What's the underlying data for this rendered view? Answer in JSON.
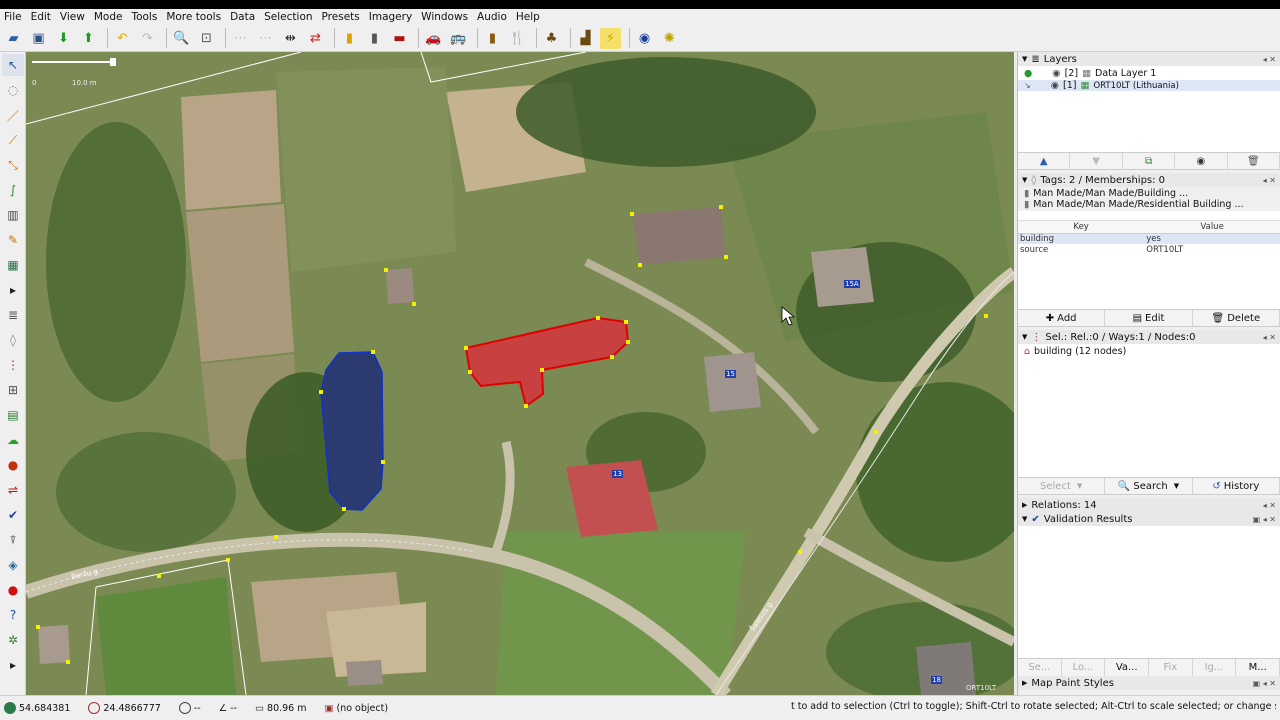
{
  "menu": [
    "File",
    "Edit",
    "View",
    "Mode",
    "Tools",
    "More tools",
    "Data",
    "Selection",
    "Presets",
    "Imagery",
    "Windows",
    "Audio",
    "Help"
  ],
  "map": {
    "scale_left": "0",
    "scale_right": "10.0 m",
    "street_berzu": "Beržų g.",
    "street_salesos": "Šalesos g.",
    "label_1": "15A",
    "label_2": "15",
    "label_3": "13",
    "label_4": "18",
    "watermark": "ORT10LT"
  },
  "layers": {
    "title": "Layers",
    "items": [
      {
        "index": "[2]",
        "name": "Data Layer 1"
      },
      {
        "index": "[1]",
        "name": "ORT10LT (Lithuania)"
      }
    ]
  },
  "tags": {
    "title": "Tags: 2 / Memberships: 0",
    "presets": [
      "Man Made/Man Made/Building ...",
      "Man Made/Man Made/Residential Building ..."
    ],
    "key_header": "Key",
    "value_header": "Value",
    "rows": [
      {
        "key": "building",
        "value": "yes"
      },
      {
        "key": "source",
        "value": "ORT10LT"
      }
    ],
    "add": "Add",
    "edit": "Edit",
    "delete": "Delete"
  },
  "selection": {
    "title": "Sel.: Rel.:0 / Ways:1 / Nodes:0",
    "item": "building (12 nodes)",
    "select": "Select",
    "search": "Search",
    "history": "History"
  },
  "relations": {
    "title": "Relations: 14"
  },
  "validation": {
    "title": "Validation Results"
  },
  "bottom_tabs": [
    "Se...",
    "Lo...",
    "Va...",
    "Fix",
    "Ig...",
    "M..."
  ],
  "map_paint": {
    "title": "Map Paint Styles"
  },
  "status": {
    "lat": "54.684381",
    "lon": "24.4866777",
    "heading": "--",
    "angle": "--",
    "distance": "80.96 m",
    "object": "(no object)",
    "message": "t to add to selection (Ctrl to toggle); Shift-Ctrl to rotate selected; Alt-Ctrl to scale selected; or change selection"
  },
  "colors": {
    "selected_way": "#e00000",
    "pond_way": "#1030d0",
    "node": "#f2f200"
  }
}
